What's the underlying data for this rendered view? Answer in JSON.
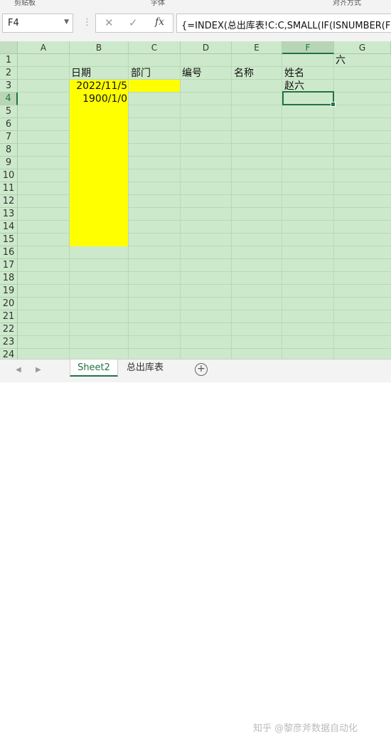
{
  "ribbon": {
    "group_labels": [
      "剪贴板",
      "字体",
      "对齐方式"
    ]
  },
  "formula_bar": {
    "name_box": "F4",
    "formula": "{=INDEX(总出库表!C:C,SMALL(IF(ISNUMBER(FIN"
  },
  "sheet": {
    "columns": [
      "A",
      "B",
      "C",
      "D",
      "E",
      "F",
      "G"
    ],
    "selected_column": "F",
    "selected_row": "4",
    "rows": [
      "1",
      "2",
      "3",
      "4",
      "5",
      "6",
      "7",
      "8",
      "9",
      "10",
      "11",
      "12",
      "13",
      "14",
      "15",
      "16",
      "17",
      "18",
      "19",
      "20",
      "21",
      "22",
      "23",
      "24"
    ],
    "cells": {
      "G1": "六",
      "B2": "日期",
      "C2": "部门",
      "D2": "编号",
      "E2": "名称",
      "F2": "姓名",
      "B3": "2022/11/5",
      "F3": "赵六",
      "B4": "1900/1/0"
    },
    "highlight_color": "#ffff00",
    "grid_color": "#cde9cb"
  },
  "tabs": {
    "sheets": [
      "Sheet2",
      "总出库表"
    ],
    "active": "Sheet2"
  },
  "watermark": "知乎 @黎彦斧数据自动化"
}
